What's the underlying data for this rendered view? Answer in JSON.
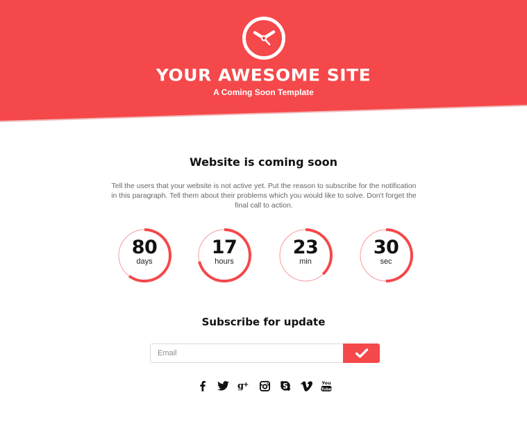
{
  "header": {
    "title": "YOUR AWESOME SITE",
    "subtitle": "A Coming Soon Template",
    "logo_icon": "clock-icon",
    "background_color": "#f5484a"
  },
  "main": {
    "heading": "Website is coming soon",
    "paragraph": "Tell the users that your website is not active yet. Put the reason to subscribe for the notification in this paragraph. Tell them about their problems which you would like to solve. Don't forget the final call to action."
  },
  "countdown": [
    {
      "value": "80",
      "unit": "days",
      "progress": 0.6
    },
    {
      "value": "17",
      "unit": "hours",
      "progress": 0.71
    },
    {
      "value": "23",
      "unit": "min",
      "progress": 0.38
    },
    {
      "value": "30",
      "unit": "sec",
      "progress": 0.5
    }
  ],
  "subscribe": {
    "heading": "Subscribe for update",
    "email_placeholder": "Email",
    "email_value": "",
    "submit_icon": "check-icon"
  },
  "social": [
    {
      "name": "facebook",
      "icon": "facebook-icon"
    },
    {
      "name": "twitter",
      "icon": "twitter-icon"
    },
    {
      "name": "google-plus",
      "icon": "google-plus-icon"
    },
    {
      "name": "instagram",
      "icon": "instagram-icon"
    },
    {
      "name": "skype",
      "icon": "skype-icon"
    },
    {
      "name": "vimeo",
      "icon": "vimeo-icon"
    },
    {
      "name": "youtube",
      "icon": "youtube-icon"
    }
  ],
  "colors": {
    "accent": "#f5484a",
    "ring_track": "#f5484a",
    "text_dark": "#111111",
    "text_muted": "#666666"
  }
}
